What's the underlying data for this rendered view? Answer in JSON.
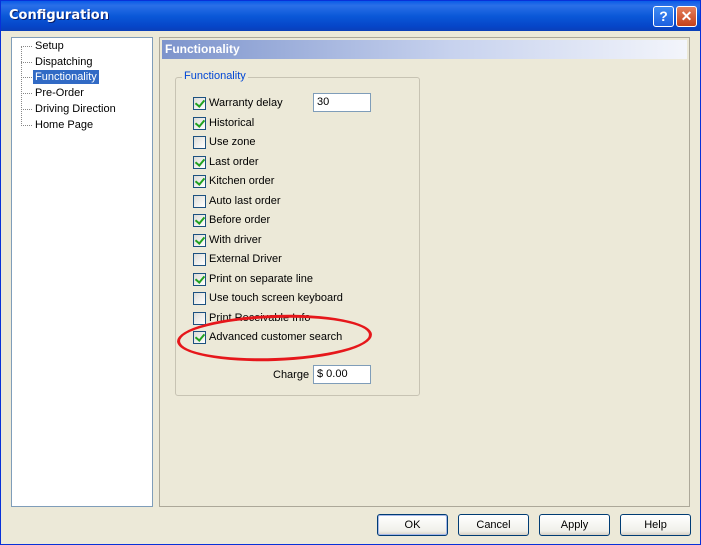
{
  "window": {
    "title": "Configuration",
    "help_icon": "help-icon",
    "close_icon": "close-icon"
  },
  "tree": {
    "items": [
      {
        "label": "Setup"
      },
      {
        "label": "Dispatching"
      },
      {
        "label": "Functionality",
        "selected": true
      },
      {
        "label": "Pre-Order"
      },
      {
        "label": "Driving Direction"
      },
      {
        "label": "Home Page"
      }
    ]
  },
  "panel": {
    "header": "Functionality",
    "group_title": "Functionality"
  },
  "options": [
    {
      "label": "Warranty delay",
      "checked": true
    },
    {
      "label": "Historical",
      "checked": true
    },
    {
      "label": "Use zone",
      "checked": false
    },
    {
      "label": "Last order",
      "checked": true
    },
    {
      "label": "Kitchen order",
      "checked": true
    },
    {
      "label": "Auto last order",
      "checked": false
    },
    {
      "label": "Before order",
      "checked": true
    },
    {
      "label": "With driver",
      "checked": true
    },
    {
      "label": "External Driver",
      "checked": false
    },
    {
      "label": "Print on separate line",
      "checked": true
    },
    {
      "label": "Use touch screen keyboard",
      "checked": false
    },
    {
      "label": "Print Receivable Info",
      "checked": false
    },
    {
      "label": "Advanced customer search",
      "checked": true
    }
  ],
  "fields": {
    "warranty_delay_value": "30",
    "charge_label": "Charge",
    "charge_value": "$ 0.00"
  },
  "annotation": {
    "color": "#e6171b"
  },
  "buttons": {
    "ok": "OK",
    "cancel": "Cancel",
    "apply": "Apply",
    "help": "Help"
  }
}
